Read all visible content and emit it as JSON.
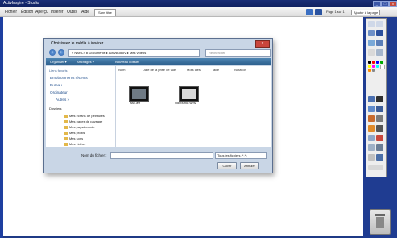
{
  "window": {
    "title": "ActivInspire - Studio",
    "controls": [
      "_",
      "□",
      "x"
    ]
  },
  "menu": {
    "items": [
      "Fichier",
      "Édition",
      "Aperçu",
      "Insérer",
      "Outils",
      "Aide"
    ],
    "tab": "Sans titre",
    "page_label": "Page 1 sur 1",
    "flipchart_label": "Ajouter à la page"
  },
  "dialog": {
    "title": "Choisissez le média à insérer",
    "path": "« NARCY ▸ Documents ▸ ActivstudioV ▸ Mes vidéos",
    "search_placeholder": "Rechercher",
    "toolbar": [
      "Organiser ▾",
      "Affichages ▾",
      "Nouveau dossier"
    ],
    "sidebar_header": "Liens favoris",
    "favorites": [
      "Emplacements récents",
      "Bureau",
      "Ordinateur"
    ],
    "more": "Autres »",
    "folders_header": "Dossiers",
    "folders": [
      "Mes écrans de peintures",
      "Mes pages de paysage",
      "Mes paysdomnde",
      "Mes profils",
      "Mes sons",
      "Mes vidéos"
    ],
    "columns": [
      "Nom",
      "Date de la prise de vue",
      "Mots clés",
      "Taille",
      "Notation"
    ],
    "files": [
      "ssc.avi",
      "vid0d0hut.wmv"
    ],
    "filename_label": "Nom du fichier :",
    "filter": "Tous les fichiers (*.*)",
    "open_label": "Ouvrir",
    "cancel_label": "Annuler"
  },
  "palette": {
    "colors": [
      "#000000",
      "#ff0000",
      "#0000ff",
      "#00aa00",
      "#ffff00",
      "#ff00ff",
      "#00ffff",
      "#ffffff",
      "#ff8800",
      "#888888"
    ]
  }
}
